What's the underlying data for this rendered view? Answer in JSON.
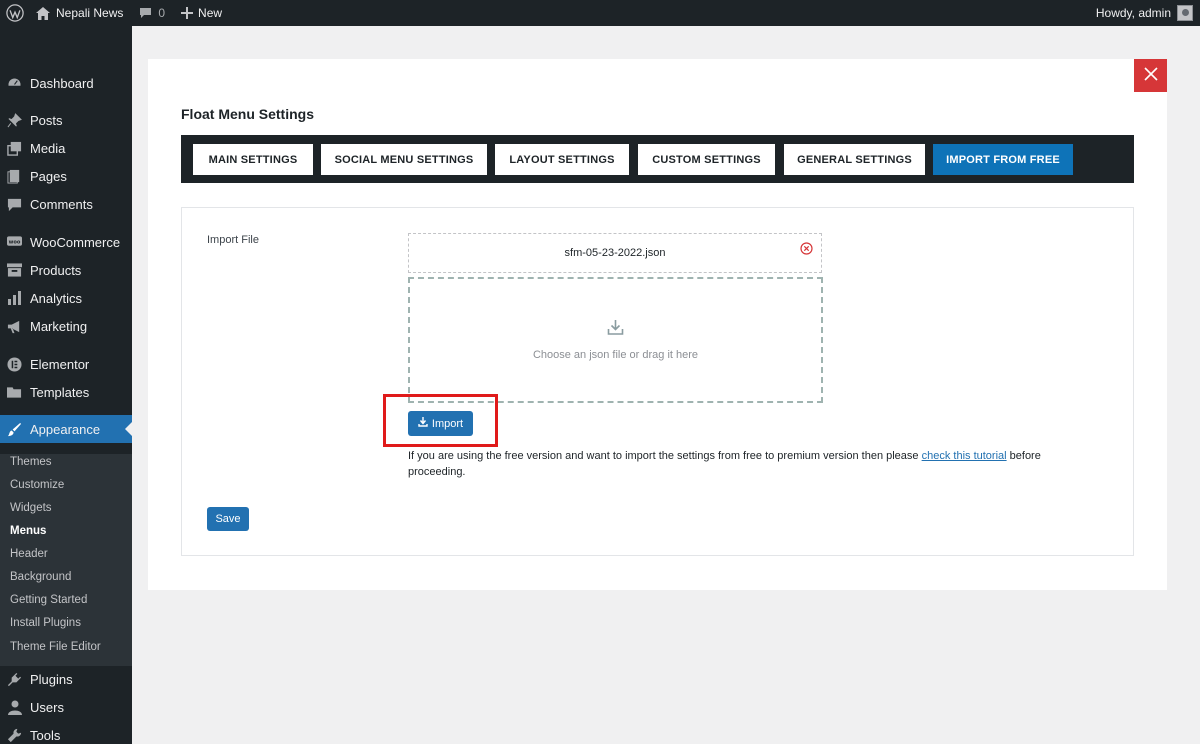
{
  "admin_bar": {
    "site_name": "Nepali News",
    "comments_count": "0",
    "new_label": "New",
    "greeting": "Howdy, admin"
  },
  "sidebar": {
    "items": [
      {
        "label": "Dashboard",
        "icon": "dashboard-icon"
      },
      {
        "label": "Posts",
        "icon": "pin-icon"
      },
      {
        "label": "Media",
        "icon": "media-icon"
      },
      {
        "label": "Pages",
        "icon": "pages-icon"
      },
      {
        "label": "Comments",
        "icon": "comment-icon"
      },
      {
        "label": "WooCommerce",
        "icon": "woo-icon"
      },
      {
        "label": "Products",
        "icon": "archive-icon"
      },
      {
        "label": "Analytics",
        "icon": "chart-icon"
      },
      {
        "label": "Marketing",
        "icon": "megaphone-icon"
      },
      {
        "label": "Elementor",
        "icon": "elementor-icon"
      },
      {
        "label": "Templates",
        "icon": "folder-icon"
      },
      {
        "label": "Appearance",
        "icon": "brush-icon"
      },
      {
        "label": "Plugins",
        "icon": "plug-icon"
      },
      {
        "label": "Users",
        "icon": "user-icon"
      },
      {
        "label": "Tools",
        "icon": "wrench-icon"
      }
    ],
    "submenu": [
      "Themes",
      "Customize",
      "Widgets",
      "Menus",
      "Header",
      "Background",
      "Getting Started",
      "Install Plugins",
      "Theme File Editor"
    ],
    "submenu_current": "Menus"
  },
  "page": {
    "title": "Float Menu Settings",
    "tabs": [
      "MAIN SETTINGS",
      "SOCIAL MENU SETTINGS",
      "LAYOUT SETTINGS",
      "CUSTOM SETTINGS",
      "GENERAL SETTINGS",
      "IMPORT FROM FREE"
    ],
    "active_tab": "IMPORT FROM FREE",
    "import_file_label": "Import File",
    "file_name": "sfm-05-23-2022.json",
    "drop_text": "Choose an json file or drag it here",
    "import_button": "Import",
    "notice_before": "If you are using the free version and want to import the settings from free to premium version then please ",
    "notice_link": "check this tutorial",
    "notice_after": " before proceeding.",
    "save_button": "Save"
  },
  "colors": {
    "admin_dark": "#1d2327",
    "accent_blue": "#2271b1",
    "tab_active": "#0e73b8",
    "close_red": "#d63638",
    "highlight_red": "#e01a1a"
  }
}
